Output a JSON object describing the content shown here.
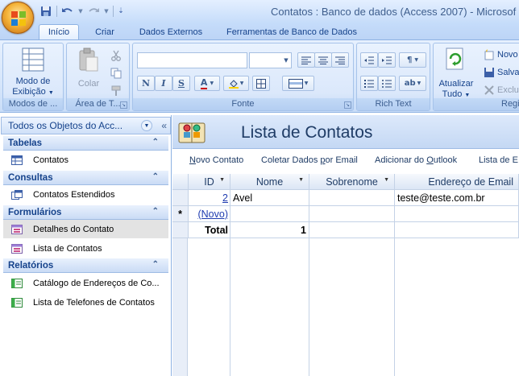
{
  "window": {
    "title": "Contatos : Banco de dados (Access 2007) - Microsof"
  },
  "tabs": [
    {
      "label": "Início",
      "active": true
    },
    {
      "label": "Criar",
      "active": false
    },
    {
      "label": "Dados Externos",
      "active": false
    },
    {
      "label": "Ferramentas de Banco de Dados",
      "active": false
    }
  ],
  "ribbon": {
    "groups": {
      "modos": "Modos de ...",
      "area": "Área de T...",
      "fonte": "Fonte",
      "rich": "Rich Text",
      "registros": "Regi"
    },
    "modo_exibicao": {
      "line1": "Modo de",
      "line2": "Exibição"
    },
    "colar": "Colar",
    "atualizar": {
      "line1": "Atualizar",
      "line2": "Tudo"
    },
    "novo": "Novo",
    "salvar": "Salva",
    "excluir": "Exclu"
  },
  "nav": {
    "header": "Todos os Objetos do Acc...",
    "groups": [
      {
        "label": "Tabelas",
        "items": [
          {
            "label": "Contatos",
            "icon": "table-icon"
          }
        ]
      },
      {
        "label": "Consultas",
        "items": [
          {
            "label": "Contatos Estendidos",
            "icon": "query-icon"
          }
        ]
      },
      {
        "label": "Formulários",
        "items": [
          {
            "label": "Detalhes do Contato",
            "icon": "form-icon",
            "selected": true
          },
          {
            "label": "Lista de Contatos",
            "icon": "form-icon"
          }
        ]
      },
      {
        "label": "Relatórios",
        "items": [
          {
            "label": "Catálogo de Endereços de Co...",
            "icon": "report-icon"
          },
          {
            "label": "Lista de Telefones de Contatos",
            "icon": "report-icon"
          }
        ]
      }
    ]
  },
  "form": {
    "title": "Lista de Contatos",
    "links": [
      "Novo Contato",
      "Coletar Dados por Email",
      "Adicionar do Outlook",
      "Lista de E"
    ]
  },
  "sheet": {
    "columns": [
      "ID",
      "Nome",
      "Sobrenome",
      "Endereço de Email"
    ],
    "rows": [
      {
        "id": "2",
        "nome": "Avel",
        "sobrenome": "",
        "email": "teste@teste.com.br"
      }
    ],
    "new_row": {
      "marker": "*",
      "id": "(Novo)"
    },
    "total": {
      "label": "Total",
      "value": "1"
    }
  },
  "colors": {
    "accent": "#15428b",
    "ribbon": "#d6e6fb"
  }
}
